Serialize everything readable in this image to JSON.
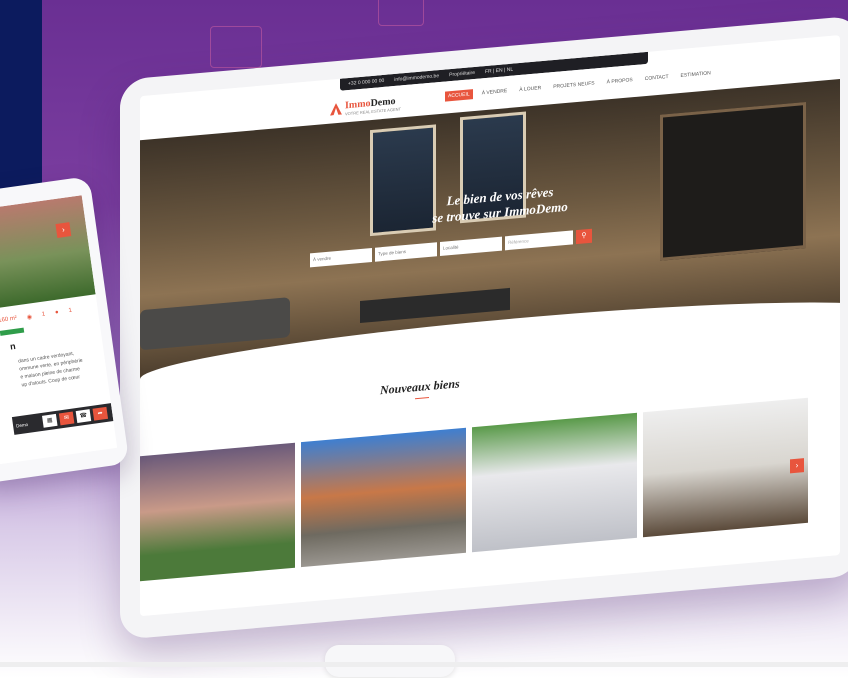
{
  "brand": {
    "name_part1": "Immo",
    "name_part2": "Demo",
    "tagline": "VOTRE REAL ESTATE AGENT",
    "accent": "#e8553d",
    "dark_panel": "#0c1b5e"
  },
  "topbar": {
    "phone": "+32 0 000 00 00",
    "email": "info@immodemo.be",
    "owner": "Propriétaire",
    "languages": "FR | EN | NL"
  },
  "nav": {
    "items": [
      "ACCUEIL",
      "À VENDRE",
      "À LOUER",
      "PROJETS NEUFS",
      "À PROPOS",
      "CONTACT",
      "ESTIMATION"
    ]
  },
  "hero": {
    "title_line1": "Le bien de vos rêves",
    "title_line2": "se trouve sur ImmoDemo",
    "search": {
      "type_label": "À vendre",
      "property_type_label": "Type de biens",
      "location_label": "Localité",
      "reference_placeholder": "Référence",
      "search_icon": "search-icon"
    }
  },
  "listings": {
    "section_title": "Nouveaux biens",
    "cards": [
      {
        "image": "white-house-sunset"
      },
      {
        "image": "modern-house-garage"
      },
      {
        "image": "white-apartment-building"
      },
      {
        "image": "living-room-interior"
      }
    ],
    "next_icon": "chevron-right-icon"
  },
  "phone_card": {
    "area": "160 m²",
    "bedrooms": "1",
    "parking": "1",
    "title_fragment": "n",
    "description_lines": [
      "dans un cadre verdoyant,",
      "ommune verte, en périphérie",
      "e maison pleine de charme",
      "up d'atouts. Coup de cœur"
    ],
    "bar_label": "Demo",
    "icons": [
      "grid-icon",
      "mail-icon",
      "phone-icon",
      "share-icon"
    ]
  }
}
